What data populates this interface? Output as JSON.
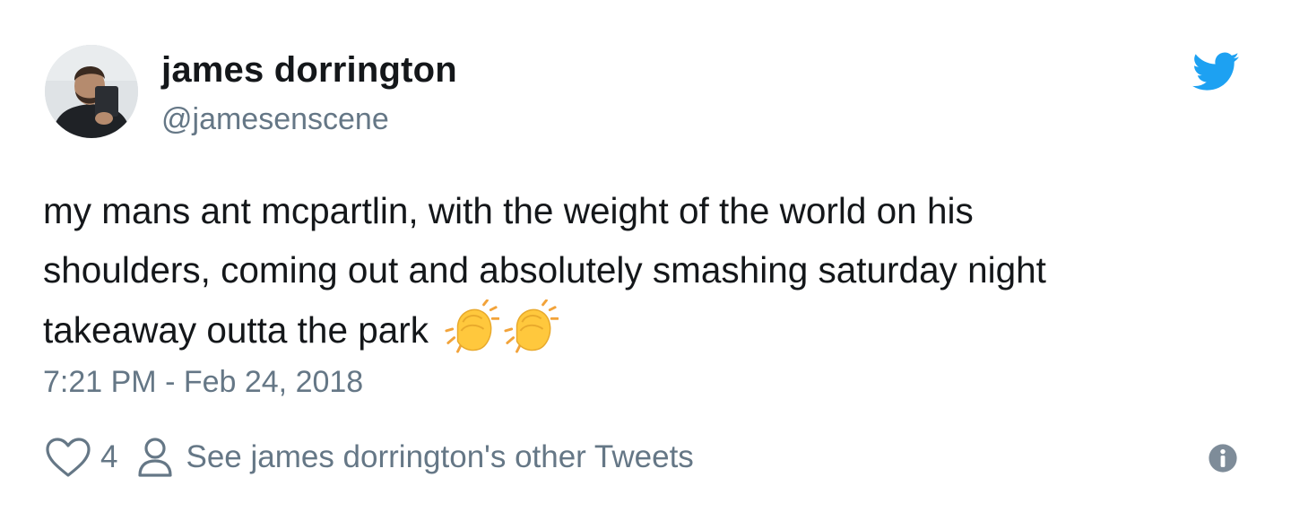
{
  "tweet": {
    "display_name": "james dorrington",
    "handle": "@jamesenscene",
    "text_lines": [
      "my mans ant mcpartlin, with the weight of the world on his",
      "shoulders, coming out and absolutely smashing saturday night",
      "takeaway outta the park"
    ],
    "emoji": [
      "clapping-hands",
      "clapping-hands"
    ],
    "timestamp": "7:21 PM - Feb 24, 2018",
    "like_count": "4",
    "other_tweets_link": "See james dorrington's other Tweets"
  },
  "icons": {
    "brand": "twitter-bird-icon",
    "like": "heart-icon",
    "profile": "person-icon",
    "info": "info-icon"
  },
  "colors": {
    "twitter_blue": "#1da1f2",
    "text": "#14171a",
    "secondary_text": "#657786",
    "emoji_yellow": "#ffc83d"
  }
}
